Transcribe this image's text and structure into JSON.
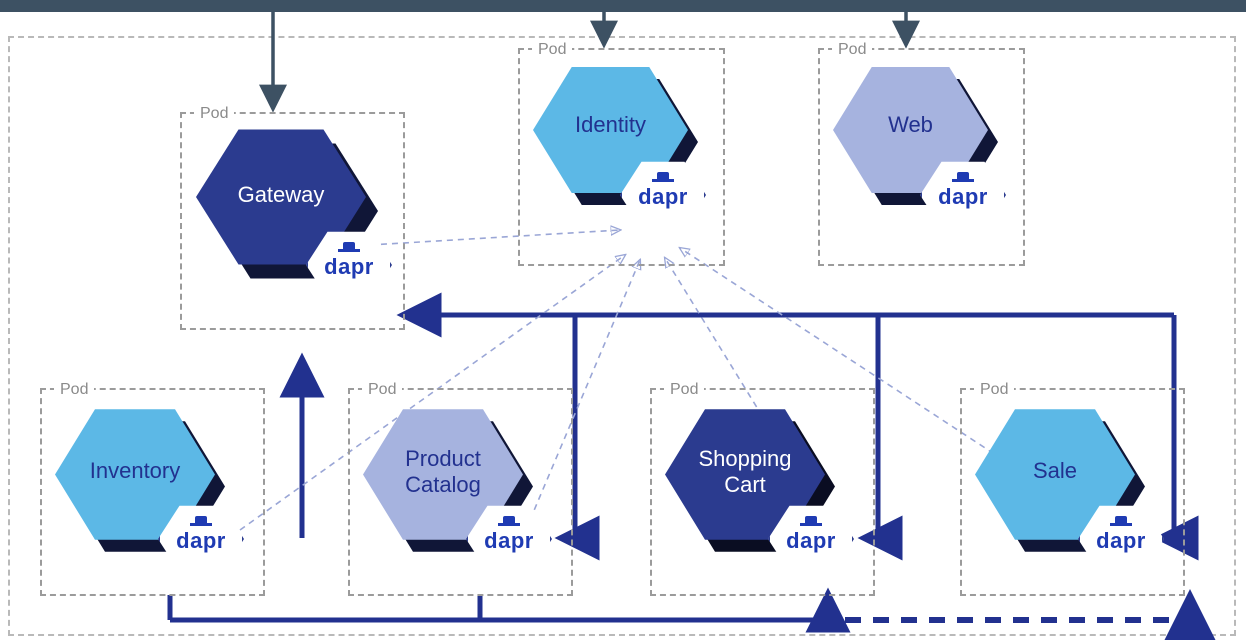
{
  "podLabel": "Pod",
  "daprLabel": "dapr",
  "services": {
    "gateway": {
      "label": "Gateway",
      "color": "#2b3b8f"
    },
    "identity": {
      "label": "Identity",
      "color": "#5cb8e6"
    },
    "web": {
      "label": "Web",
      "color": "#a6b3df"
    },
    "inventory": {
      "label": "Inventory",
      "color": "#5cb8e6"
    },
    "productCatalog": {
      "label": "Product\nCatalog",
      "color": "#a6b3df"
    },
    "shoppingCart": {
      "label": "Shopping\nCart",
      "color": "#2b3b8f"
    },
    "sale": {
      "label": "Sale",
      "color": "#5cb8e6"
    }
  },
  "colors": {
    "topBar": "#3d5163",
    "solidArrow": "#22318f",
    "dashThin": "#9aa6d6"
  }
}
